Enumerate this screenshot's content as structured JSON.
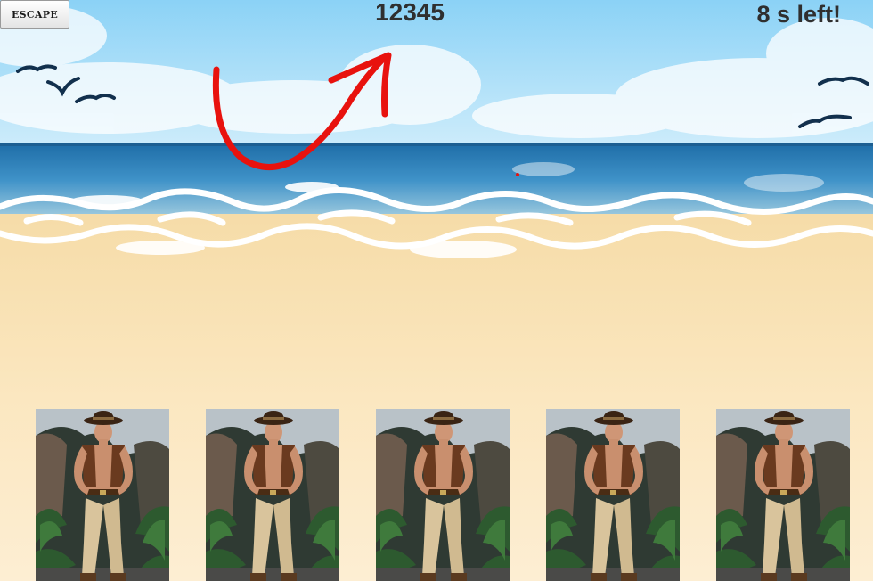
{
  "escape_button": {
    "label": "ESCAPE"
  },
  "score": "12345",
  "timer": "8 s left!",
  "hint": {
    "gesture": "red-curved-arrow-up-right",
    "color": "#e8120e"
  },
  "colors": {
    "sky": "#8fd4f7",
    "sea": "#2f86c0",
    "foam": "#ffffff",
    "sand": "#fbe5b9"
  },
  "cards": [
    {
      "image": "man-in-outback-hat-and-vest"
    },
    {
      "image": "man-in-outback-hat-and-vest"
    },
    {
      "image": "man-in-outback-hat-and-vest"
    },
    {
      "image": "man-in-outback-hat-and-vest"
    },
    {
      "image": "man-in-outback-hat-and-vest"
    }
  ]
}
